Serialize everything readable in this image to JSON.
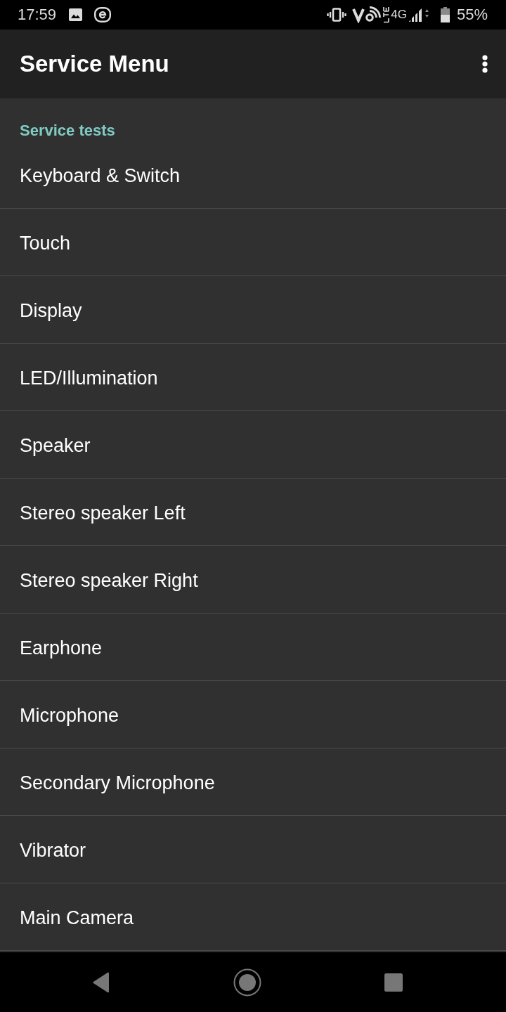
{
  "status_bar": {
    "time": "17:59",
    "network": "4G",
    "battery": "55%"
  },
  "app_bar": {
    "title": "Service Menu"
  },
  "section": {
    "title": "Service tests"
  },
  "items": [
    "Keyboard & Switch",
    "Touch",
    "Display",
    "LED/Illumination",
    "Speaker",
    "Stereo speaker Left",
    "Stereo speaker Right",
    "Earphone",
    "Microphone",
    "Secondary Microphone",
    "Vibrator",
    "Main Camera"
  ]
}
